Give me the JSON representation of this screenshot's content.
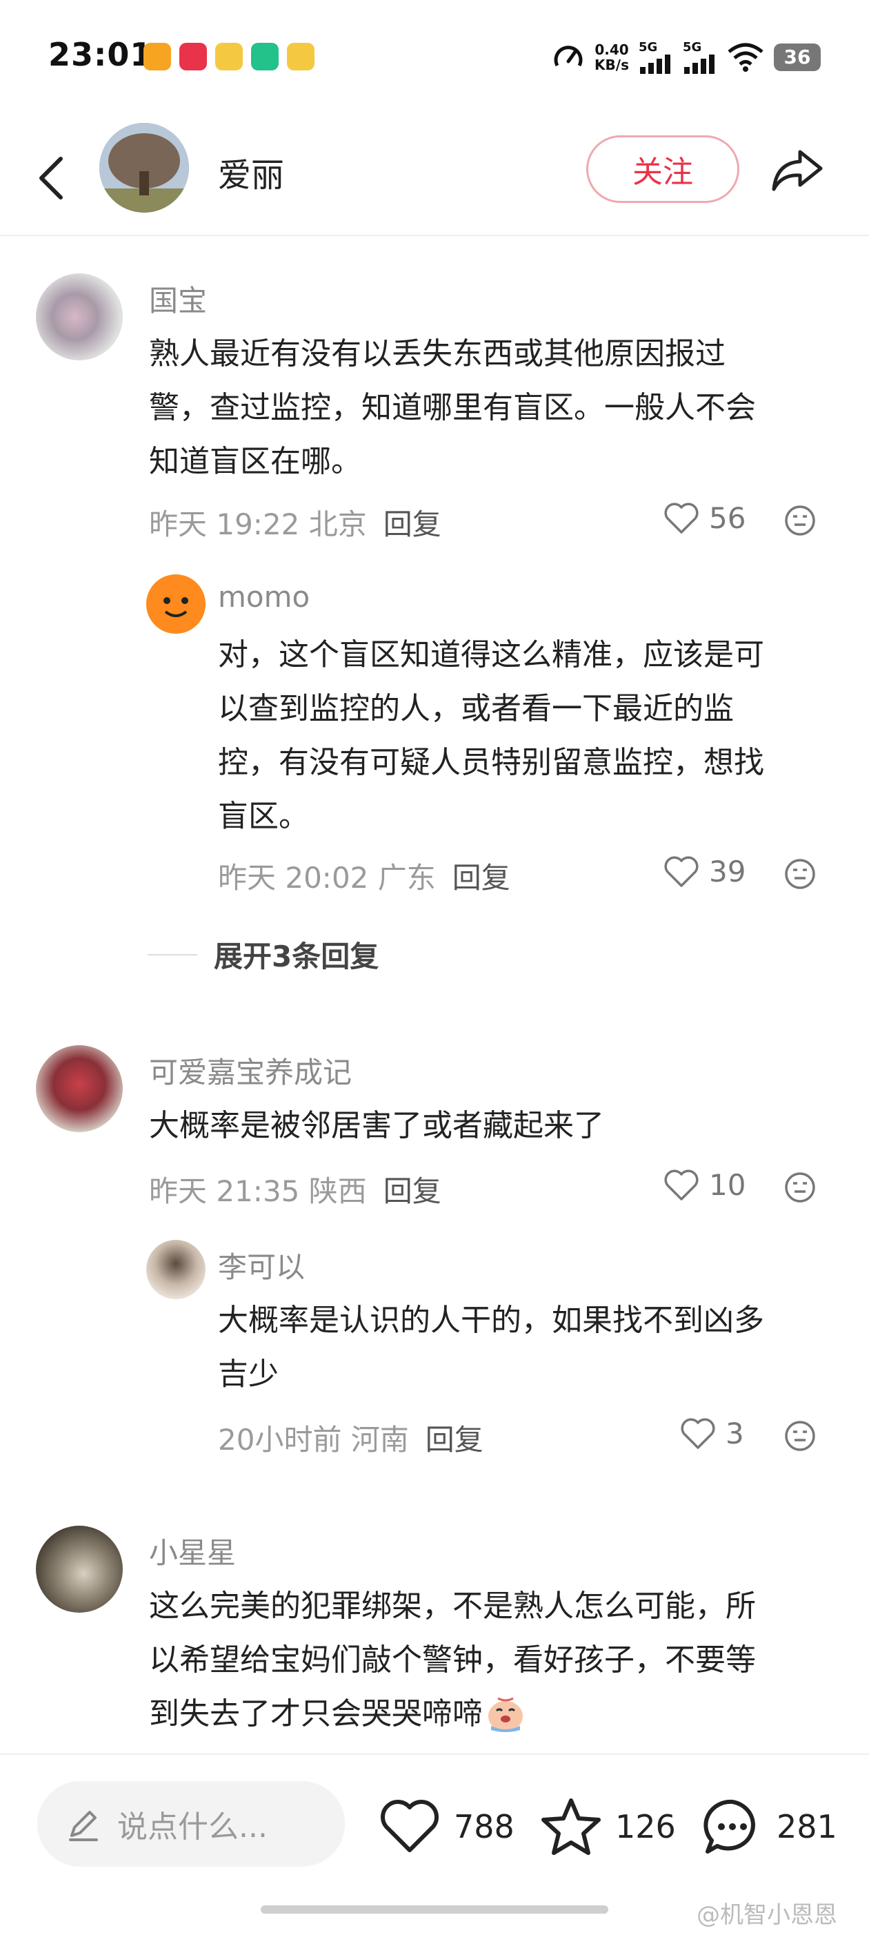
{
  "status_bar": {
    "time": "23:01",
    "speed_value": "0.40",
    "speed_unit": "KB/s",
    "net1": "5G",
    "net2": "5G",
    "battery": "36",
    "app_icons": [
      {
        "name": "app-icon-1",
        "color": "#f7a423"
      },
      {
        "name": "app-icon-2",
        "color": "#e8334a"
      },
      {
        "name": "app-icon-3",
        "color": "#f5c842"
      },
      {
        "name": "app-icon-4",
        "color": "#22c28a"
      },
      {
        "name": "app-icon-5",
        "color": "#f5c842"
      }
    ]
  },
  "header": {
    "name": "爱丽",
    "follow_label": "关注"
  },
  "comments": [
    {
      "user": "国宝",
      "text_lines": [
        "熟人最近有没有以丢失东西或其他原因报过",
        "警，查过监控，知道哪里有盲区。一般人不会",
        "知道盲区在哪。"
      ],
      "meta": "昨天 19:22 北京",
      "reply": "回复",
      "likes": "56"
    },
    {
      "user": "momo",
      "text_lines": [
        "对，这个盲区知道得这么精准，应该是可",
        "以查到监控的人，或者看一下最近的监",
        "控，有没有可疑人员特别留意监控，想找",
        "盲区。"
      ],
      "meta": "昨天 20:02 广东",
      "reply": "回复",
      "likes": "39"
    },
    {
      "user": "可爱嘉宝养成记",
      "text_lines": [
        "大概率是被邻居害了或者藏起来了"
      ],
      "meta": "昨天 21:35 陕西",
      "reply": "回复",
      "likes": "10"
    },
    {
      "user": "李可以",
      "text_lines": [
        "大概率是认识的人干的，如果找不到凶多",
        "吉少"
      ],
      "meta": "20小时前 河南",
      "reply": "回复",
      "likes": "3"
    },
    {
      "user": "小星星",
      "text_lines": [
        "这么完美的犯罪绑架，不是熟人怎么可能，所",
        "以希望给宝妈们敲个警钟，看好孩子，不要等",
        "到失去了才只会哭哭啼啼"
      ]
    }
  ],
  "expand_label": "展开3条回复",
  "bottom_bar": {
    "placeholder": "说点什么...",
    "likes": "788",
    "favorites": "126",
    "comments": "281"
  },
  "watermark": "@机智小恩恩",
  "colors": {
    "accent": "#e8334a",
    "follow_border": "#f0a8b0",
    "meta_gray": "#9a9a9a"
  }
}
